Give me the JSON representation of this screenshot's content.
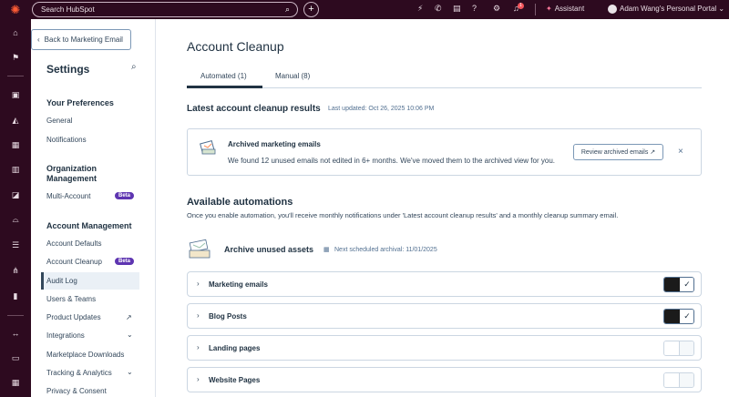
{
  "topbar": {
    "search_placeholder": "Search HubSpot",
    "notification_count": "1",
    "assistant_label": "Assistant",
    "portal_name": "Adam Wang's Personal Portal"
  },
  "sidebar": {
    "back_label": "Back to Marketing Email",
    "title": "Settings",
    "sections": {
      "preferences": "Your Preferences",
      "org": "Organization Management",
      "account": "Account Management"
    },
    "items": {
      "general": "General",
      "notifications": "Notifications",
      "multi_account": "Multi-Account",
      "account_defaults": "Account Defaults",
      "account_cleanup": "Account Cleanup",
      "audit_log": "Audit Log",
      "users_teams": "Users & Teams",
      "product_updates": "Product Updates",
      "integrations": "Integrations",
      "marketplace_downloads": "Marketplace Downloads",
      "tracking_analytics": "Tracking & Analytics",
      "privacy_consent": "Privacy & Consent"
    },
    "beta_label": "Beta"
  },
  "main": {
    "page_title": "Account Cleanup",
    "tabs": [
      {
        "label": "Automated (1)",
        "active": true
      },
      {
        "label": "Manual (8)",
        "active": false
      }
    ],
    "latest_title": "Latest account cleanup results",
    "last_updated": "Last updated: Oct 26, 2025 10:06 PM",
    "card": {
      "title": "Archived marketing emails",
      "description": "We found 12 unused emails not edited in 6+ months. We've moved them to the archived view for you.",
      "button_label": "Review archived emails"
    },
    "available_title": "Available automations",
    "available_desc": "Once you enable automation, you'll receive monthly notifications under 'Latest account cleanup results' and a monthly cleanup summary email.",
    "archive_title": "Archive unused assets",
    "next_scheduled": "Next scheduled archival: 11/01/2025",
    "rows": [
      {
        "label": "Marketing emails",
        "enabled": true
      },
      {
        "label": "Blog Posts",
        "enabled": true
      },
      {
        "label": "Landing pages",
        "enabled": false
      },
      {
        "label": "Website Pages",
        "enabled": false
      }
    ]
  },
  "colors": {
    "nav_bg": "#2d0a1f",
    "accent": "#ff5c35",
    "beta": "#5e35b1",
    "text": "#33475b"
  }
}
